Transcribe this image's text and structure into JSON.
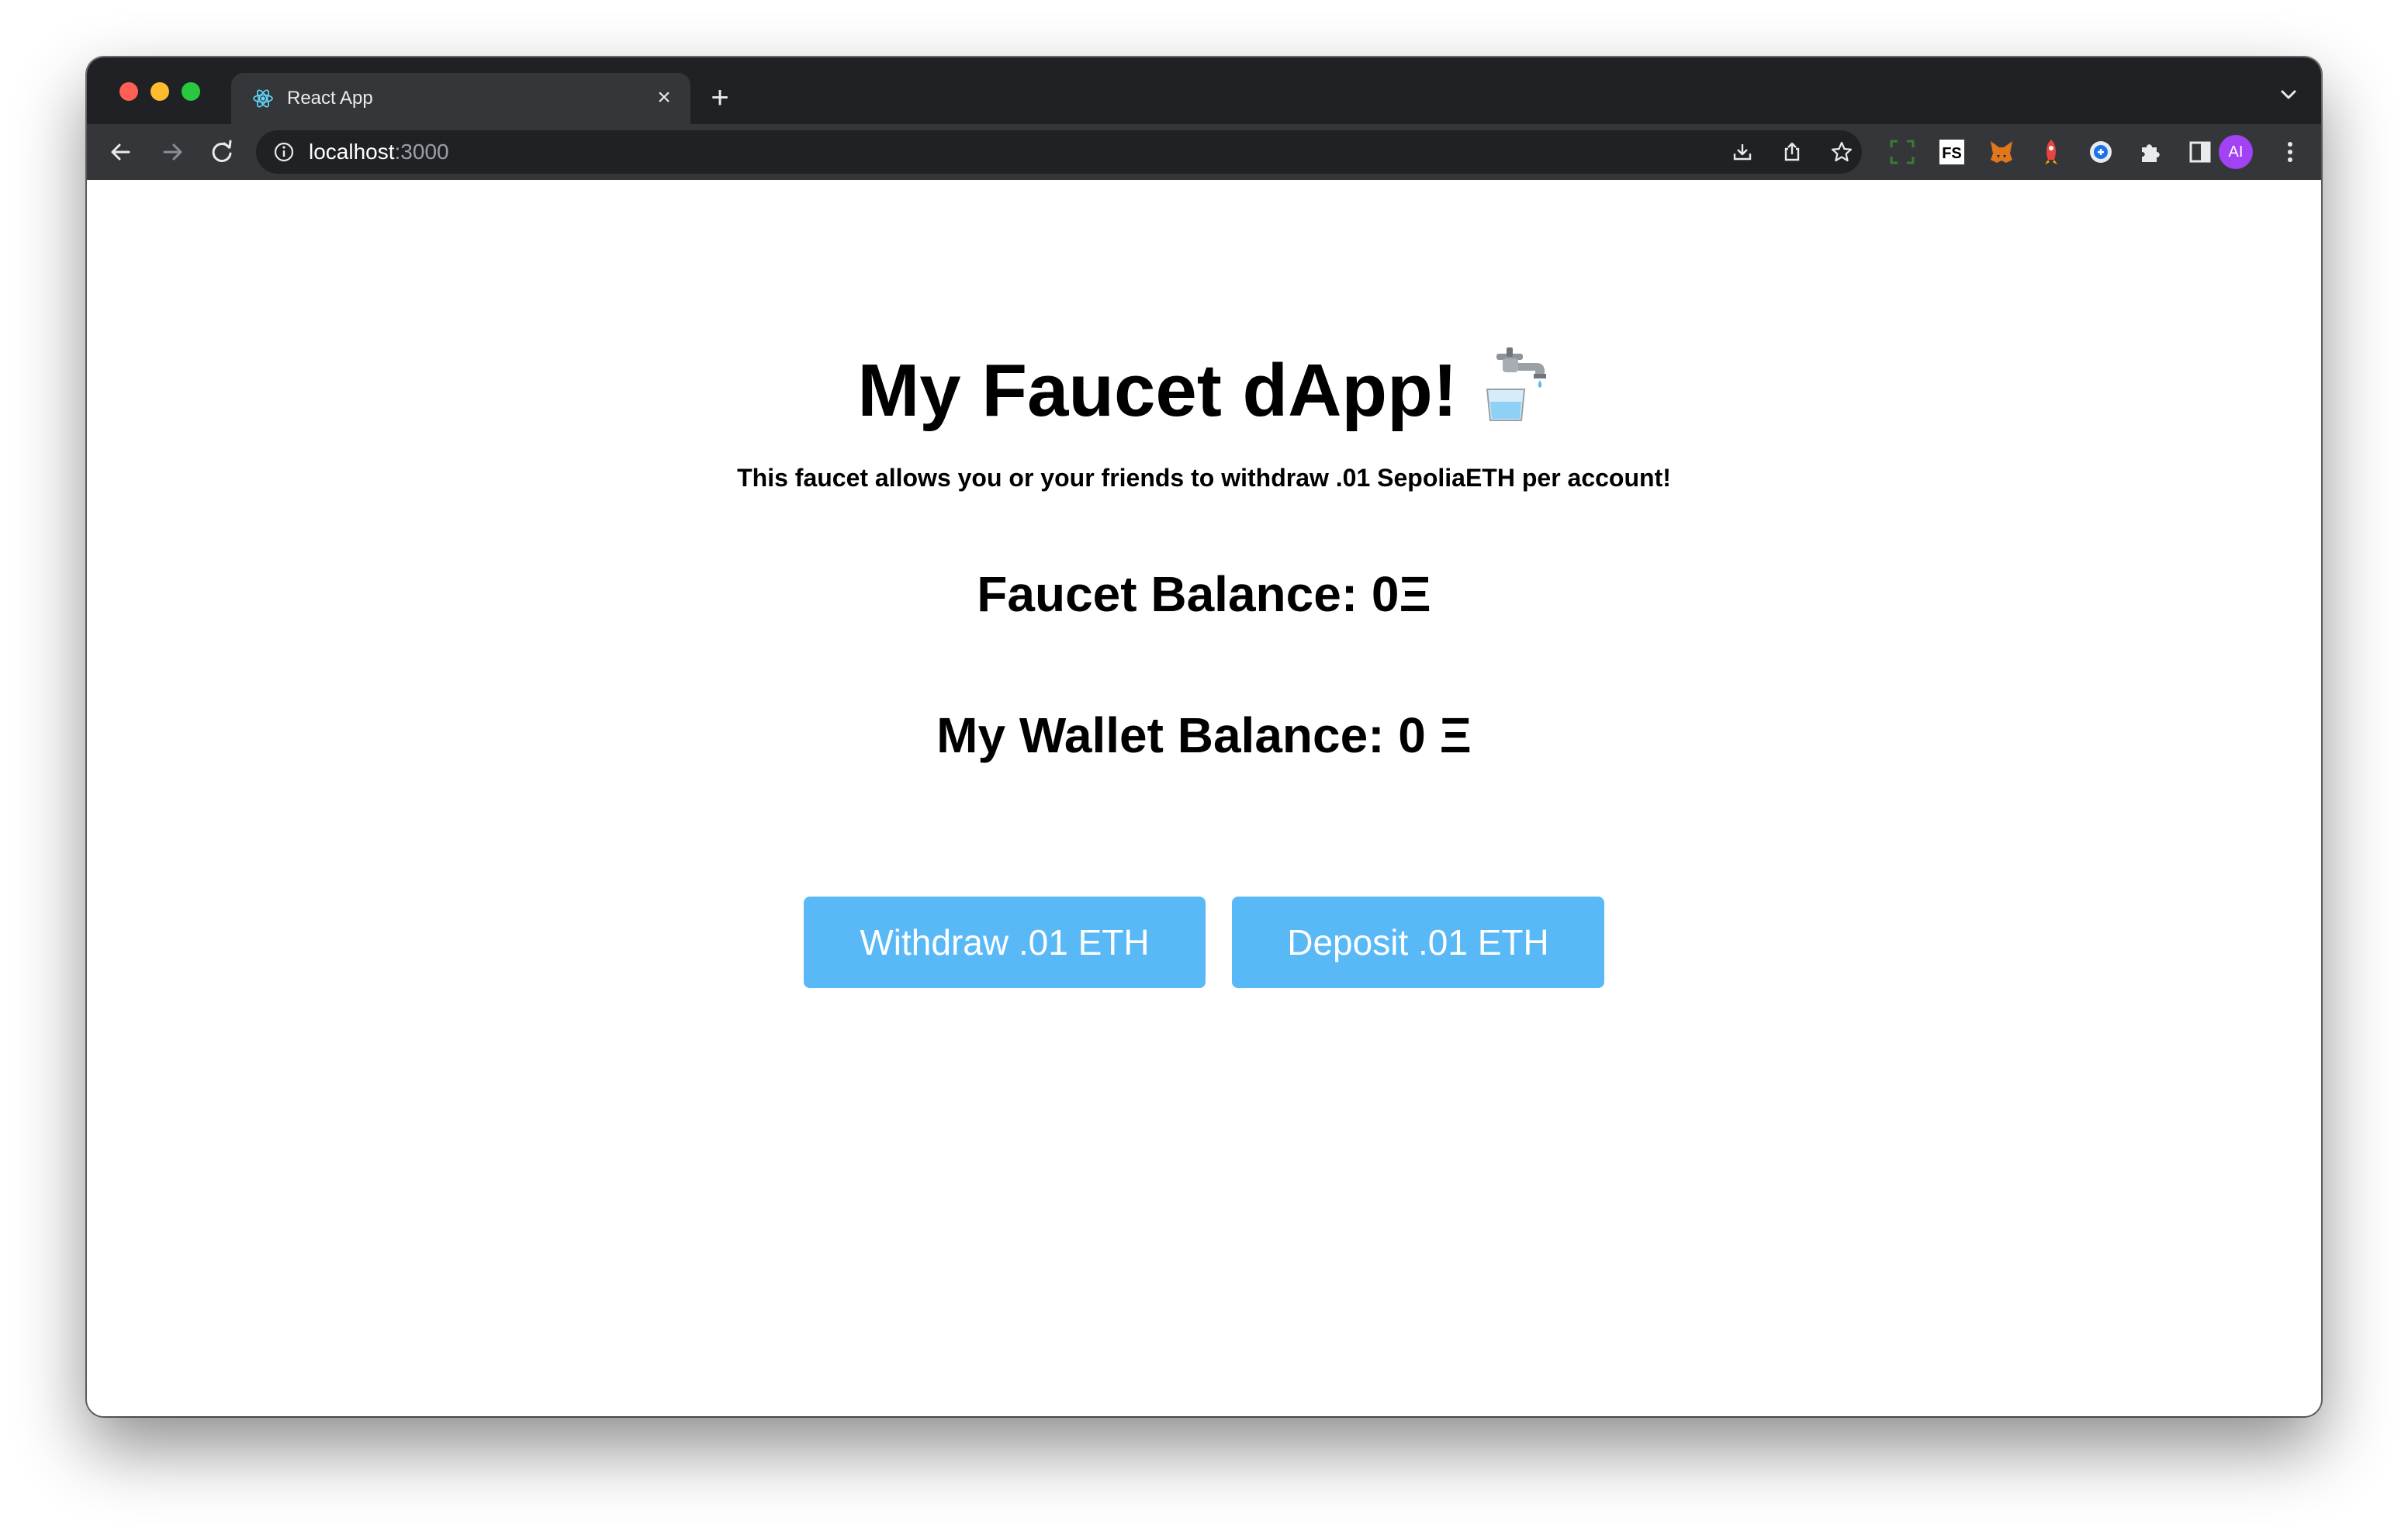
{
  "browser": {
    "tab": {
      "title": "React App",
      "favicon": "react-icon",
      "close_icon": "close-icon"
    },
    "new_tab_icon": "plus-icon",
    "tab_menu_icon": "chevron-down-icon",
    "nav": {
      "back_icon": "back-arrow-icon",
      "forward_icon": "forward-arrow-icon",
      "reload_icon": "reload-icon"
    },
    "address": {
      "host": "localhost",
      "port": ":3000",
      "info_icon": "info-icon"
    },
    "omnibox_icons": [
      "install-app-icon",
      "share-icon",
      "bookmark-star-icon"
    ],
    "extensions": [
      "screenshot-extension-icon",
      "fs-extension-icon",
      "metamask-fox-icon",
      "rocket-extension-icon",
      "wallet-extension-icon",
      "puzzle-extensions-icon",
      "side-panel-icon"
    ],
    "profile": {
      "initials": "AI",
      "color": "#a142f4"
    },
    "menu_icon": "more-vertical-icon"
  },
  "page": {
    "title": "My Faucet dApp!",
    "title_icon": "faucet-icon",
    "subtitle": "This faucet allows you or your friends to withdraw .01 SepoliaETH per account!",
    "faucet_balance": "Faucet Balance: 0Ξ",
    "wallet_balance": "My Wallet Balance: 0 Ξ",
    "buttons": {
      "withdraw": "Withdraw .01 ETH",
      "deposit": "Deposit .01 ETH"
    },
    "button_color": "#59b9f6"
  }
}
